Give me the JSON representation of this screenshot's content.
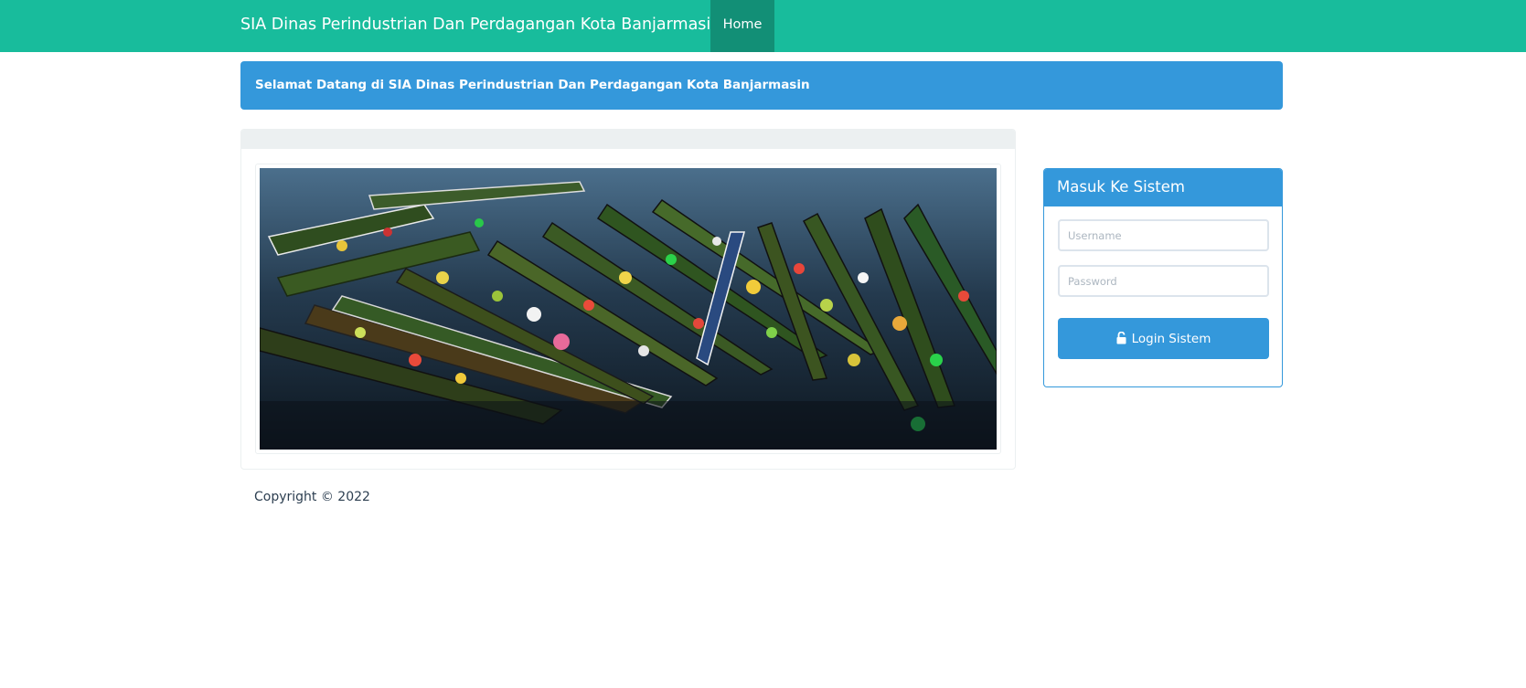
{
  "navbar": {
    "brand": "SIA Dinas Perindustrian Dan Perdagangan Kota Banjarmasin",
    "home_label": "Home"
  },
  "welcome": {
    "text": "Selamat Datang di SIA Dinas Perindustrian Dan Perdagangan Kota Banjarmasin"
  },
  "banner": {
    "alt": "Floating market boats"
  },
  "login": {
    "title": "Masuk Ke Sistem",
    "username_placeholder": "Username",
    "password_placeholder": "Password",
    "button_label": "Login Sistem",
    "button_icon": "unlock-icon"
  },
  "footer": {
    "copyright": "Copyright © 2022"
  },
  "colors": {
    "navbar": "#18bc9c",
    "navbar_active": "#128f76",
    "primary": "#3498db",
    "panel_heading": "#ecf0f1"
  }
}
